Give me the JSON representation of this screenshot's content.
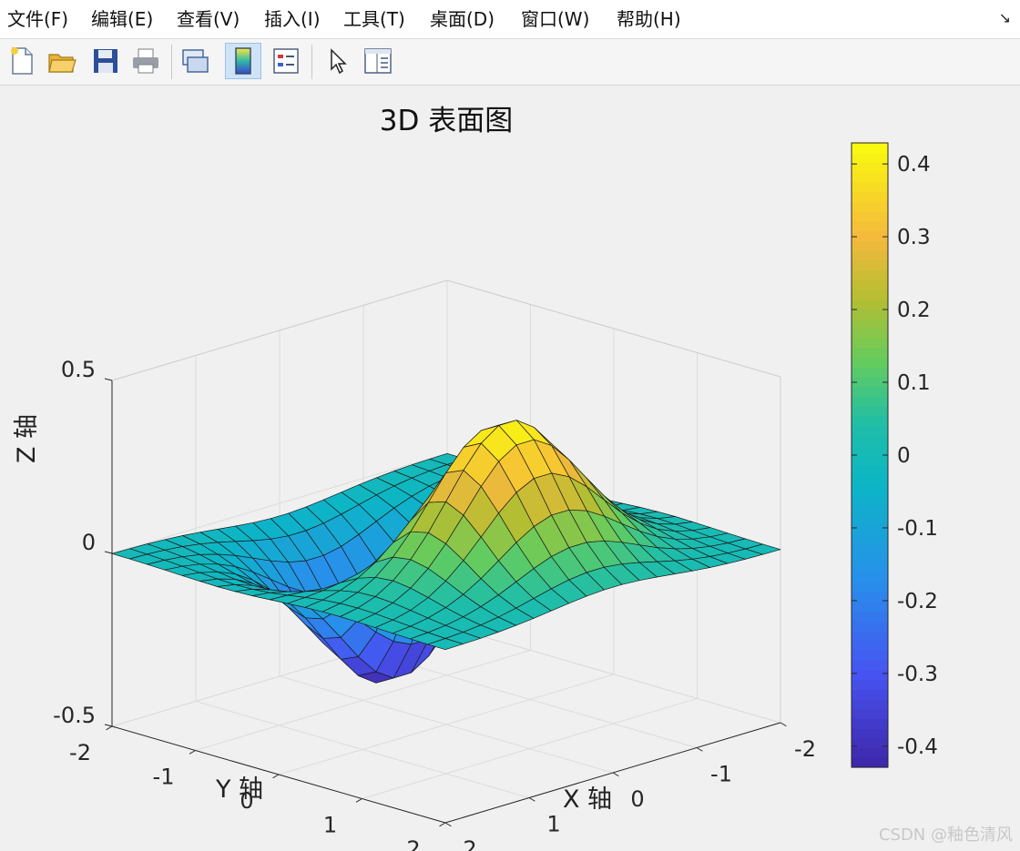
{
  "menu": {
    "items": [
      "文件(F)",
      "编辑(E)",
      "查看(V)",
      "插入(I)",
      "工具(T)",
      "桌面(D)",
      "窗口(W)",
      "帮助(H)"
    ],
    "corner_icon": "dock-arrow-icon"
  },
  "toolbar": {
    "buttons": [
      "new-figure-icon",
      "open-file-icon",
      "save-icon",
      "print-icon",
      "link-plot-icon",
      "insert-colorbar-icon",
      "insert-legend-icon",
      "edit-plot-pointer-icon",
      "property-inspector-icon"
    ],
    "active": "insert-colorbar-icon"
  },
  "chart_data": {
    "type": "surface",
    "title": "3D 表面图",
    "xlabel": "X 轴",
    "ylabel": "Y 轴",
    "zlabel": "Z 轴",
    "function": "z = x * exp(-x^2 - y^2)",
    "xlim": [
      -2,
      2
    ],
    "ylim": [
      -2,
      2
    ],
    "zlim": [
      -0.5,
      0.5
    ],
    "grid_points": 20,
    "x_ticks": [
      "-2",
      "-1",
      "0",
      "1",
      "2"
    ],
    "y_ticks": [
      "-2",
      "-1",
      "0",
      "1",
      "2"
    ],
    "z_ticks": [
      "-0.5",
      "0",
      "0.5"
    ],
    "colormap": "parula",
    "colorbar": {
      "ticks": [
        "0.4",
        "0.3",
        "0.2",
        "0.1",
        "0",
        "-0.1",
        "-0.2",
        "-0.3",
        "-0.4"
      ],
      "tick_values": [
        0.4,
        0.3,
        0.2,
        0.1,
        0,
        -0.1,
        -0.2,
        -0.3,
        -0.4
      ],
      "range": [
        -0.4289,
        0.4289
      ]
    },
    "view": {
      "azimuth": -37.5,
      "elevation": 30
    },
    "grid": true
  },
  "watermark": "CSDN @釉色清风"
}
